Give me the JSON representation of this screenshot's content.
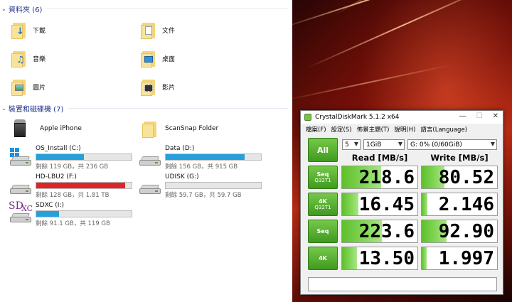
{
  "folders_group": {
    "title": "資料夾 (6)",
    "items": [
      {
        "label": "下載",
        "icon": "downloads-folder-icon"
      },
      {
        "label": "文件",
        "icon": "documents-folder-icon"
      },
      {
        "label": "音樂",
        "icon": "music-folder-icon"
      },
      {
        "label": "桌面",
        "icon": "desktop-folder-icon"
      },
      {
        "label": "圖片",
        "icon": "pictures-folder-icon"
      },
      {
        "label": "影片",
        "icon": "videos-folder-icon"
      }
    ]
  },
  "devices_group": {
    "title": "裝置和磁碟機 (7)",
    "items": [
      {
        "name": "Apple iPhone",
        "icon": "iphone-device-icon"
      },
      {
        "name": "ScanSnap Folder",
        "icon": "scansnap-folder-icon"
      },
      {
        "name": "OS_Install (C:)",
        "free": "剩餘 119 GB，共 236 GB",
        "used_fraction": 0.5,
        "critical": false
      },
      {
        "name": "Data (D:)",
        "free": "剩餘 156 GB，共 915 GB",
        "used_fraction": 0.83,
        "critical": false
      },
      {
        "name": "HD-LBU2 (F:)",
        "free": "剩餘 128 GB，共 1.81 TB",
        "used_fraction": 0.93,
        "critical": true
      },
      {
        "name": "UDISK (G:)",
        "free": "剩餘 59.7 GB，共 59.7 GB",
        "used_fraction": 0.0,
        "critical": false
      },
      {
        "name": "SDXC (I:)",
        "free": "剩餘 91.1 GB，共 119 GB",
        "used_fraction": 0.24,
        "critical": false
      }
    ]
  },
  "cdm": {
    "title": "CrystalDiskMark 5.1.2 x64",
    "menu": [
      "檔案(F)",
      "設定(S)",
      "佈景主題(T)",
      "說明(H)",
      "語言(Language)"
    ],
    "all_button": "All",
    "count": "5",
    "size": "1GiB",
    "drive": "G: 0% (0/60GiB)",
    "read_header": "Read [MB/s]",
    "write_header": "Write [MB/s]",
    "rows": [
      {
        "label": "Seq",
        "sub": "Q32T1",
        "read": "218.6",
        "write": "80.52",
        "read_fill": 0.52,
        "write_fill": 0.3
      },
      {
        "label": "4K",
        "sub": "Q32T1",
        "read": "16.45",
        "write": "2.146",
        "read_fill": 0.22,
        "write_fill": 0.08
      },
      {
        "label": "Seq",
        "sub": "",
        "read": "223.6",
        "write": "92.90",
        "read_fill": 0.53,
        "write_fill": 0.33
      },
      {
        "label": "4K",
        "sub": "",
        "read": "13.50",
        "write": "1.997",
        "read_fill": 0.2,
        "write_fill": 0.07
      }
    ],
    "accent": "#5fbf2c"
  },
  "colors": {
    "bar_normal": "#26a0da",
    "bar_critical": "#da2626",
    "group_title": "#1e3287"
  }
}
